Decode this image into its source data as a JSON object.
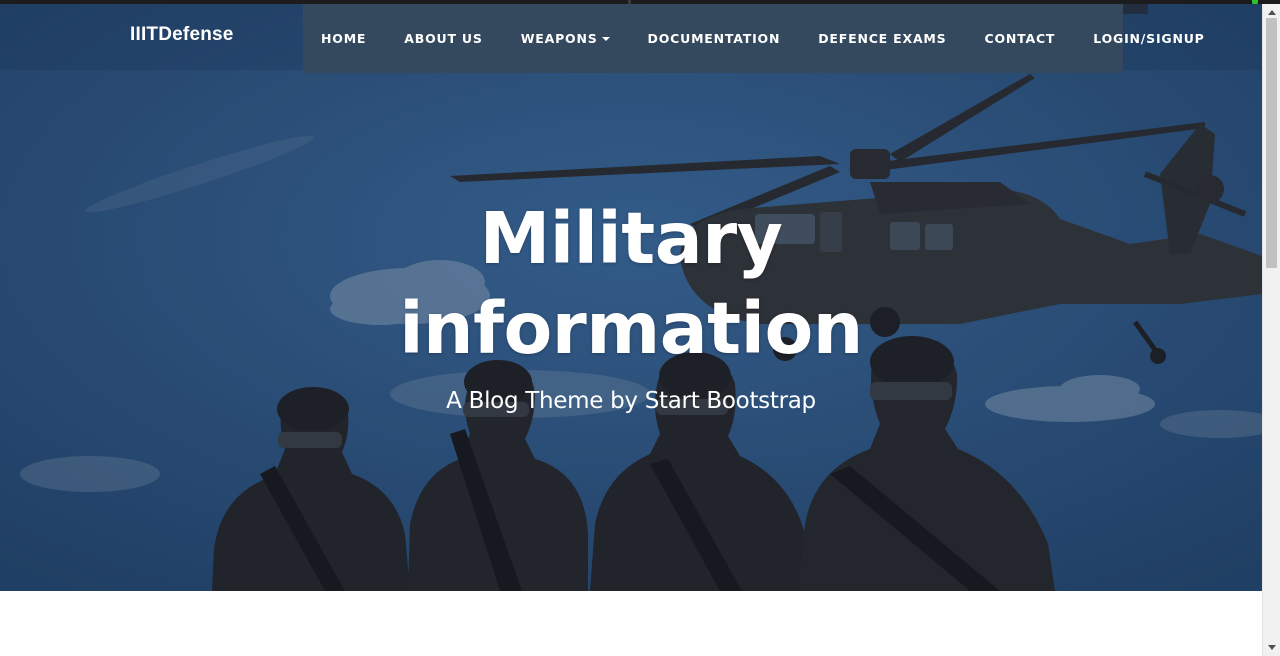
{
  "brand": {
    "name": "IIITDefense"
  },
  "nav": {
    "items": [
      {
        "label": "HOME"
      },
      {
        "label": "ABOUT US"
      },
      {
        "label": "WEAPONS",
        "dropdown": true
      },
      {
        "label": "DOCUMENTATION"
      },
      {
        "label": "DEFENCE EXAMS"
      },
      {
        "label": "CONTACT"
      },
      {
        "label": "LOGIN/SIGNUP"
      }
    ]
  },
  "hero": {
    "title_line1": "Military",
    "title_line2": "information",
    "subtitle": "A Blog Theme by Start Bootstrap"
  },
  "colors": {
    "menu_bg": "#34495e",
    "hero_sky": "#2f5f92",
    "text": "#ffffff"
  },
  "icons": {
    "dropdown": "caret-down-icon",
    "scroll_up": "scroll-up-arrow-icon",
    "scroll_down": "scroll-down-arrow-icon"
  }
}
